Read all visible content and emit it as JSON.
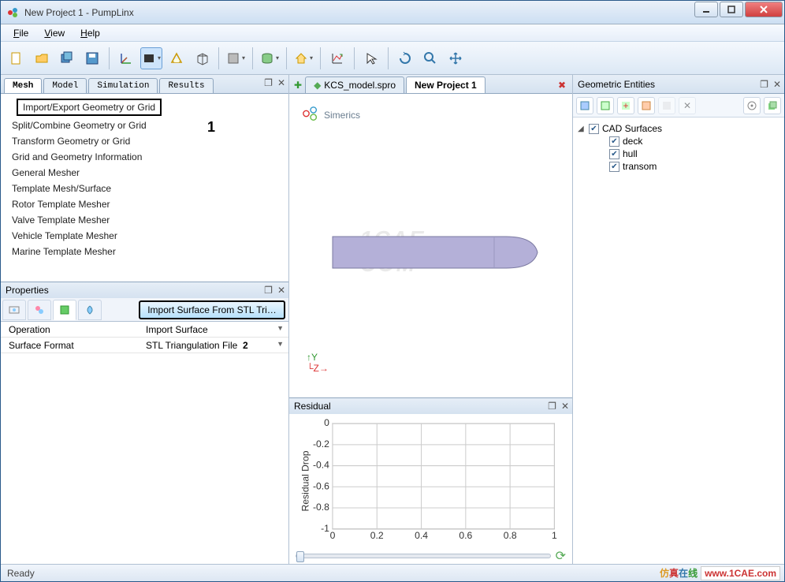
{
  "window": {
    "title": "New Project 1 - PumpLinx"
  },
  "menu": {
    "file": "File",
    "view": "View",
    "help": "Help"
  },
  "left_tabs": [
    "Mesh",
    "Model",
    "Simulation",
    "Results"
  ],
  "mesh_items": [
    "Import/Export Geometry or Grid",
    "Split/Combine Geometry or Grid",
    "Transform Geometry or Grid",
    "Grid and Geometry Information",
    "General Mesher",
    "Template Mesh/Surface",
    "Rotor Template Mesher",
    "Valve Template Mesher",
    "Vehicle Template Mesher",
    "Marine Template Mesher"
  ],
  "annotations": {
    "one": "1",
    "two": "2"
  },
  "properties": {
    "title": "Properties",
    "import_button": "Import Surface From STL Tri…",
    "rows": [
      {
        "k": "Operation",
        "v": "Import Surface"
      },
      {
        "k": "Surface Format",
        "v": "STL Triangulation File"
      }
    ]
  },
  "docs": {
    "tab1": "KCS_model.spro",
    "tab2": "New Project 1"
  },
  "viewer": {
    "logo": "Simerics",
    "watermark": "1CAE . COM",
    "axis_y": "Y",
    "axis_z": "Z→"
  },
  "residual": {
    "title": "Residual",
    "ylabel": "Residual Drop"
  },
  "chart_data": {
    "type": "line",
    "title": "",
    "xlabel": "",
    "ylabel": "Residual Drop",
    "xlim": [
      0,
      1
    ],
    "ylim": [
      -1,
      0
    ],
    "xticks": [
      0,
      0.2,
      0.4,
      0.6,
      0.8,
      1
    ],
    "yticks": [
      0,
      -0.2,
      -0.4,
      -0.6,
      -0.8,
      -1
    ],
    "series": []
  },
  "geo": {
    "title": "Geometric Entities",
    "root": "CAD Surfaces",
    "items": [
      "deck",
      "hull",
      "transom"
    ]
  },
  "status": "Ready",
  "footer": {
    "cn": "仿真在线",
    "url": "www.1CAE.com"
  }
}
